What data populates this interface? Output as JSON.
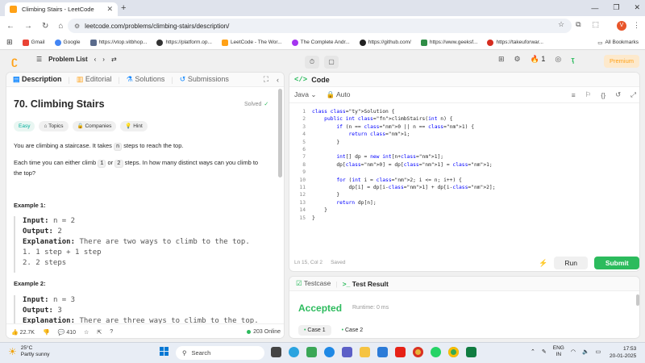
{
  "browser": {
    "tab_title": "Climbing Stairs - LeetCode",
    "url": "leetcode.com/problems/climbing-stairs/description/",
    "profile_initial": "V",
    "bookmarks": [
      {
        "label": "Gmail",
        "color": "#ea4335"
      },
      {
        "label": "Google",
        "color": "#4285f4"
      },
      {
        "label": "https://vtop.vitbhop...",
        "color": "#5a6b8c"
      },
      {
        "label": "https://platform.op...",
        "color": "#333333"
      },
      {
        "label": "LeetCode - The Wor...",
        "color": "#ffa116"
      },
      {
        "label": "The Complete Andr...",
        "color": "#a435f0"
      },
      {
        "label": "https://github.com/",
        "color": "#222222"
      },
      {
        "label": "https://www.geeksf...",
        "color": "#2f8d46"
      },
      {
        "label": "https://takeuforwar...",
        "color": "#d62d20"
      }
    ],
    "all_bookmarks": "All Bookmarks"
  },
  "nav": {
    "problem_list": "Problem List",
    "streak": "1",
    "premium": "Premium"
  },
  "left_tabs": {
    "description": "Description",
    "editorial": "Editorial",
    "solutions": "Solutions",
    "submissions": "Submissions"
  },
  "problem": {
    "title": "70. Climbing Stairs",
    "solved": "Solved",
    "tags": {
      "difficulty": "Easy",
      "topics": "Topics",
      "companies": "Companies",
      "hint": "Hint"
    },
    "desc_1_a": "You are climbing a staircase. It takes",
    "desc_1_code": "n",
    "desc_1_b": "steps to reach the top.",
    "desc_2_a": "Each time you can either climb",
    "desc_2_code1": "1",
    "desc_2_or": "or",
    "desc_2_code2": "2",
    "desc_2_b": "steps. In how many distinct ways can you climb to the top?",
    "example1": {
      "heading": "Example 1:",
      "input_label": "Input:",
      "input": "n = 2",
      "output_label": "Output:",
      "output": "2",
      "expl_label": "Explanation:",
      "expl": "There are two ways to climb to the top.",
      "l1": "1. 1 step + 1 step",
      "l2": "2. 2 steps"
    },
    "example2": {
      "heading": "Example 2:",
      "input_label": "Input:",
      "input": "n = 3",
      "output_label": "Output:",
      "output": "3",
      "expl_label": "Explanation:",
      "expl": "There are three ways to climb to the top."
    }
  },
  "left_footer": {
    "likes": "22.7K",
    "comments": "410",
    "online": "203 Online"
  },
  "code": {
    "header": "Code",
    "language": "Java",
    "mode": "Auto",
    "lines": [
      "class Solution {",
      "    public int climbStairs(int n) {",
      "        if (n == 0 || n == 1) {",
      "            return 1;",
      "        }",
      "",
      "        int[] dp = new int[n+1];",
      "        dp[0] = dp[1] = 1;",
      "",
      "        for (int i = 2; i <= n; i++) {",
      "            dp[i] = dp[i-1] + dp[i-2];",
      "        }",
      "        return dp[n];",
      "    }",
      "}"
    ],
    "cursor": "Ln 15, Col 2",
    "saved": "Saved",
    "run": "Run",
    "submit": "Submit"
  },
  "result": {
    "testcase_tab": "Testcase",
    "result_tab": "Test Result",
    "status": "Accepted",
    "runtime": "Runtime: 0 ms",
    "case1": "Case 1",
    "case2": "Case 2"
  },
  "taskbar": {
    "temp": "25°C",
    "weather": "Partly sunny",
    "search": "Search",
    "lang1": "ENG",
    "lang2": "IN",
    "time": "17:53",
    "date": "20-01-2025"
  }
}
